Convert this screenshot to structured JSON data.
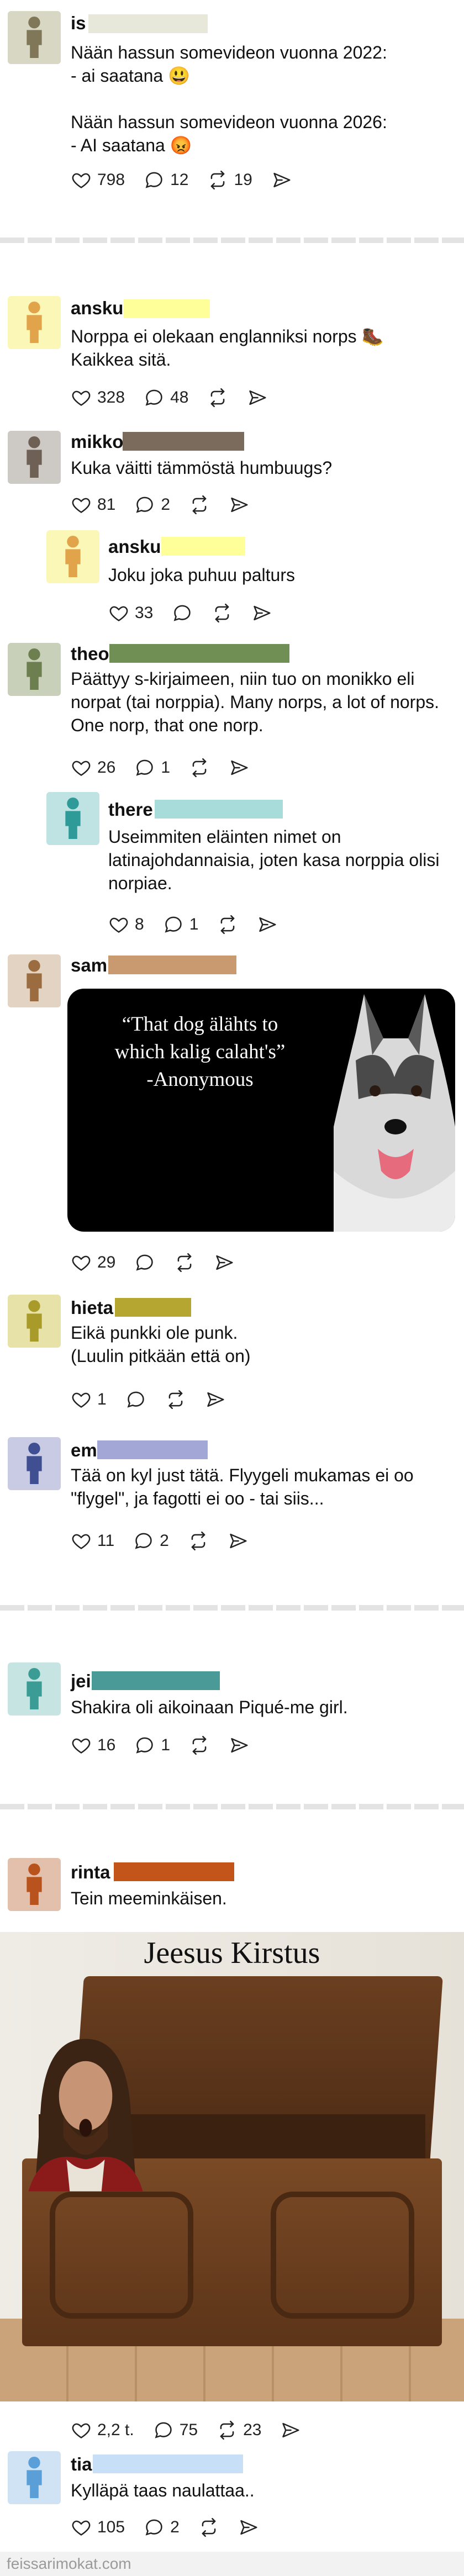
{
  "posts": [
    {
      "user": "is",
      "avatar_color": "#d8d7c3",
      "figure_color": "#7f7757",
      "bar_color": "#e7e8da",
      "text": "Nään hassun somevideon vuonna 2022:\n- ai saatana 😃\n\nNään hassun somevideon vuonna 2026:\n- AI saatana 😡",
      "likes": "798",
      "comments": "12",
      "reposts": "19"
    },
    {
      "user": "ansku",
      "avatar_color": "#fbf7b7",
      "figure_color": "#e2a44a",
      "bar_color": "#ffff99",
      "text": "Norppa ei olekaan englanniksi norps 🥾\nKaikkea sitä.",
      "likes": "328",
      "comments": "48",
      "reposts": ""
    },
    {
      "user": "mikko",
      "avatar_color": "#cdc9c4",
      "figure_color": "#6e6054",
      "bar_color": "#7a6b5c",
      "text": "Kuka väitti tämmöstä humbuugs?",
      "likes": "81",
      "comments": "2",
      "reposts": ""
    },
    {
      "user": "ansku",
      "avatar_color": "#fbf7b7",
      "figure_color": "#e2a44a",
      "bar_color": "#ffff99",
      "text": "Joku joka puhuu palturs",
      "likes": "33",
      "comments": "",
      "reposts": ""
    },
    {
      "user": "theo",
      "avatar_color": "#c9d0b9",
      "figure_color": "#6d7f4f",
      "bar_color": "#6f8f54",
      "text": "Päättyy s-kirjaimeen, niin tuo on monikko eli\nnorpat (tai norppia). Many norps, a lot of norps.\nOne norp, that one norp.",
      "likes": "26",
      "comments": "1",
      "reposts": ""
    },
    {
      "user": "there",
      "avatar_color": "#bfe2e2",
      "figure_color": "#2f9b99",
      "bar_color": "#a7dcda",
      "text": "Useimmiten eläinten nimet on\nlatinajohdannaisia, joten kasa norppia olisi\nnorpiae.",
      "likes": "8",
      "comments": "1",
      "reposts": ""
    },
    {
      "user": "sam",
      "avatar_color": "#e3d3c2",
      "figure_color": "#9a6c3f",
      "bar_color": "#c99a70",
      "quote": "“That dog älähts to\nwhich kalig calaht's”\n-Anonymous",
      "likes": "29",
      "comments": "",
      "reposts": ""
    },
    {
      "user": "hieta",
      "avatar_color": "#e6e2a8",
      "figure_color": "#a89b2a",
      "bar_color": "#b5a632",
      "text": "Eikä punkki ole punk.\n(Luulin pitkään että on)",
      "likes": "1",
      "comments": "",
      "reposts": ""
    },
    {
      "user": "em",
      "avatar_color": "#c8cbe3",
      "figure_color": "#3f4f91",
      "bar_color": "#a3a7d6",
      "text": "Tää on kyl just tätä. Flyygeli mukamas ei oo\n\"flygel\", ja fagotti ei oo - tai siis...",
      "likes": "11",
      "comments": "2",
      "reposts": ""
    },
    {
      "user": "jei",
      "avatar_color": "#c6e5e2",
      "figure_color": "#3a9c94",
      "bar_color": "#4a9b97",
      "text": "Shakira oli aikoinaan Piqué-me girl.",
      "likes": "16",
      "comments": "1",
      "reposts": ""
    },
    {
      "user": "rinta",
      "avatar_color": "#e2c0ab",
      "figure_color": "#b9531d",
      "bar_color": "#c4551a",
      "text": "Tein meeminkäisen.",
      "meme_title": "Jeesus Kirstus",
      "likes": "2,2 t.",
      "comments": "75",
      "reposts": "23"
    },
    {
      "user": "tia",
      "avatar_color": "#cfe3f5",
      "figure_color": "#5a9fd8",
      "bar_color": "#c7e0f7",
      "text": "Kylläpä taas naulattaa..",
      "likes": "105",
      "comments": "2",
      "reposts": ""
    }
  ],
  "footer": "feissarimokat.com"
}
